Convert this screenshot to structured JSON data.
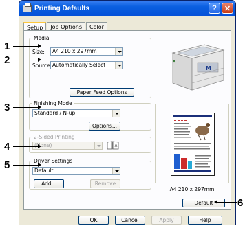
{
  "window": {
    "title": "Printing Defaults",
    "help_glyph": "?",
    "close_glyph": "✕"
  },
  "tabs": [
    {
      "label": "Setup",
      "active": true
    },
    {
      "label": "Job Options",
      "active": false
    },
    {
      "label": "Color",
      "active": false
    }
  ],
  "media": {
    "group_label": "Media",
    "size_label": "Size:",
    "size_value": "A4 210 x 297mm",
    "source_label": "Source:",
    "source_value": "Automatically Select",
    "feed_button": "Paper Feed Options"
  },
  "finishing": {
    "group_label": "Finishing Mode",
    "value": "Standard / N-up",
    "options_button": "Options..."
  },
  "two_sided": {
    "group_label": "2-Sided Printing",
    "value": "(None)"
  },
  "driver": {
    "group_label": "Driver Settings",
    "value": "Default",
    "add_button": "Add...",
    "remove_button": "Remove"
  },
  "preview": {
    "caption": "A4 210 x 297mm"
  },
  "default_button": "Default",
  "footer": {
    "ok": "OK",
    "cancel": "Cancel",
    "apply": "Apply",
    "help": "Help"
  },
  "callouts": [
    "1",
    "2",
    "3",
    "4",
    "5",
    "6"
  ],
  "colors": {
    "title_bar": "#0551d8",
    "dialog_bg": "#ece9d8",
    "tab_highlight": "#ffc83c"
  }
}
